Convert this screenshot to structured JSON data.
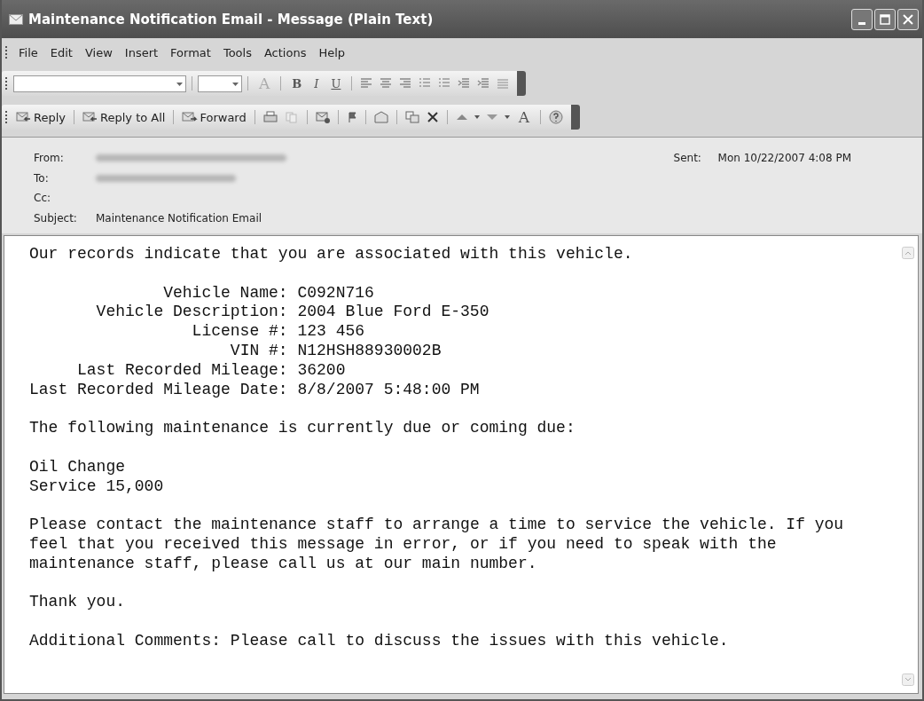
{
  "window": {
    "title": "Maintenance Notification Email - Message (Plain Text)"
  },
  "menu": [
    "File",
    "Edit",
    "View",
    "Insert",
    "Format",
    "Tools",
    "Actions",
    "Help"
  ],
  "format_toolbar": {
    "glyphs": [
      "A",
      "B",
      "I",
      "U"
    ]
  },
  "standard_toolbar": {
    "buttons": [
      "Reply",
      "Reply to All",
      "Forward"
    ],
    "font_size_glyph": "A"
  },
  "header": {
    "from_label": "From:",
    "from_redacted": true,
    "to_label": "To:",
    "to_redacted": true,
    "cc_label": "Cc:",
    "subject_label": "Subject:",
    "subject": "Maintenance Notification Email",
    "sent_label": "Sent:",
    "sent": "Mon 10/22/2007 4:08 PM"
  },
  "body": {
    "intro": "Our records indicate that you are associated with this vehicle.",
    "fields": [
      {
        "label": "Vehicle Name:",
        "value": "C092N716"
      },
      {
        "label": "Vehicle Description:",
        "value": "2004 Blue Ford E-350"
      },
      {
        "label": "License #:",
        "value": "123 456"
      },
      {
        "label": "VIN #:",
        "value": "N12HSH88930002B"
      },
      {
        "label": "Last Recorded Mileage:",
        "value": "36200"
      },
      {
        "label": "Last Recorded Mileage Date:",
        "value": "8/8/2007 5:48:00 PM"
      }
    ],
    "due_heading": "The following maintenance is currently due or coming due:",
    "due_items": [
      "Oil Change",
      "Service 15,000"
    ],
    "paragraph": "Please contact the maintenance staff to arrange a time to service the vehicle. If you\nfeel that you received this message in error, or if you need to speak with the\nmaintenance staff, please call us at our main number.",
    "thanks": "Thank you.",
    "comments": "Additional Comments: Please call to discuss the issues with this vehicle."
  }
}
